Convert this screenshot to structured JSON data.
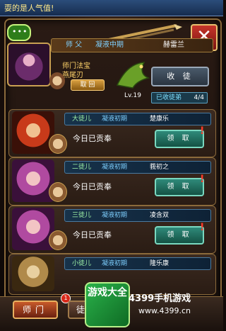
{
  "top_banner": "耍的是人气值!",
  "chat_icon_glyph": "•••",
  "close_glyph": "✕",
  "master": {
    "label": "师 父",
    "stage": "凝液中期",
    "name": "赫雷兰",
    "treasure_title": "师门法宝",
    "treasure_name": "燕尾刃",
    "retrieve_label": "取 回",
    "recruit_label": "收 徒",
    "level": "Lv.19",
    "recruited_label": "已收徒弟",
    "recruited_count": "4/4"
  },
  "disciples": [
    {
      "rank": "大徒儿",
      "stage": "凝液初期",
      "name": "楚康乐",
      "tribute": "今日已贡奉",
      "claim_label": "领 取",
      "alert": "!"
    },
    {
      "rank": "二徒儿",
      "stage": "凝液初期",
      "name": "莪初之",
      "tribute": "今日已贡奉",
      "claim_label": "领 取",
      "alert": "!"
    },
    {
      "rank": "三徒儿",
      "stage": "凝液初期",
      "name": "凌含双",
      "tribute": "今日已贡奉",
      "claim_label": "领 取",
      "alert": "!"
    },
    {
      "rank": "小徒儿",
      "stage": "凝液初期",
      "name": "隆乐康",
      "tribute": "",
      "claim_label": "",
      "alert": ""
    }
  ],
  "bottom_tabs": {
    "master_tab": "师门",
    "disciple_tab": "徒弟",
    "badge": "1"
  },
  "watermark": {
    "logo_text": "游戏大全",
    "title": "4399手机游戏",
    "url": "www.4399.cn"
  },
  "colors": {
    "accent_gold": "#c9a052",
    "claim_teal": "#2f8a7a",
    "close_red": "#c6352a"
  }
}
